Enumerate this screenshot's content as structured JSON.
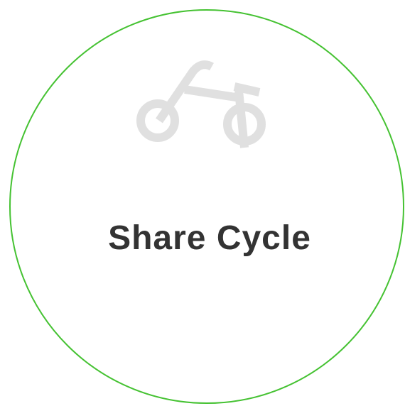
{
  "brand": {
    "name": "Share Cycle",
    "icon": "bicycle-icon",
    "ring_color": "#45c232",
    "text_color": "#333333",
    "icon_color": "#e0e0e0"
  }
}
